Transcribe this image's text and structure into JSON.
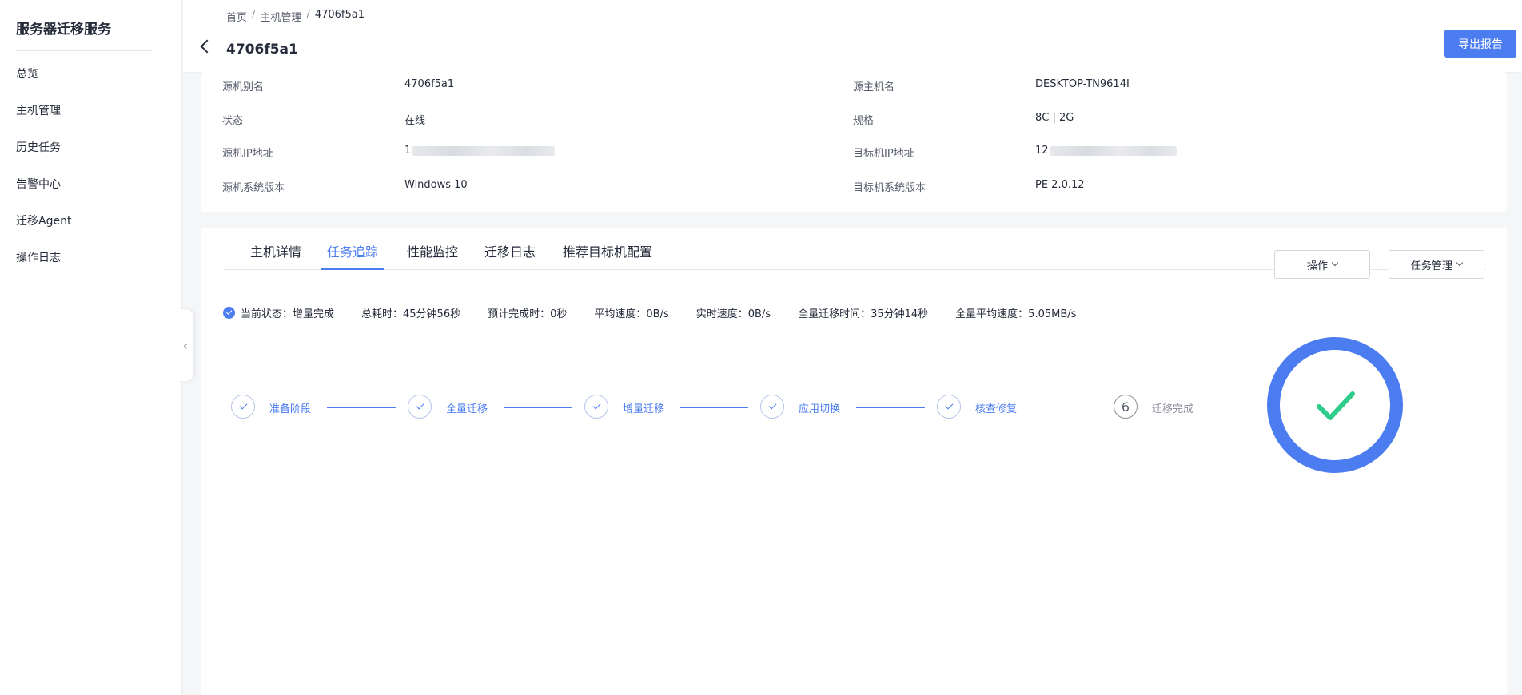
{
  "sidebar": {
    "title": "服务器迁移服务",
    "items": [
      {
        "label": "总览"
      },
      {
        "label": "主机管理"
      },
      {
        "label": "历史任务"
      },
      {
        "label": "告警中心"
      },
      {
        "label": "迁移Agent"
      },
      {
        "label": "操作日志"
      }
    ]
  },
  "header": {
    "breadcrumb": [
      "首页",
      "主机管理",
      "4706f5a1"
    ],
    "breadcrumb_sep": "/",
    "title": "4706f5a1",
    "export_label": "导出报告"
  },
  "info": {
    "source_alias_label": "源机别名",
    "source_alias": "4706f5a1",
    "source_host_label": "源主机名",
    "source_host": "DESKTOP-TN9614I",
    "status_label": "状态",
    "status": "在线",
    "spec_label": "规格",
    "spec": "8C | 2G",
    "source_ip_label": "源机IP地址",
    "source_ip_prefix": "1",
    "target_ip_label": "目标机IP地址",
    "target_ip_prefix": "12",
    "source_os_label": "源机系统版本",
    "source_os": "Windows 10",
    "target_os_label": "目标机系统版本",
    "target_os": "PE 2.0.12"
  },
  "tabs": [
    {
      "label": "主机详情"
    },
    {
      "label": "任务追踪"
    },
    {
      "label": "性能监控"
    },
    {
      "label": "迁移日志"
    },
    {
      "label": "推荐目标机配置"
    }
  ],
  "actions": {
    "operate": "操作",
    "task_manage": "任务管理"
  },
  "status_bar": {
    "current_state": "当前状态：增量完成",
    "total_time": "总耗时：45分钟56秒",
    "eta": "预计完成时：0秒",
    "avg_speed": "平均速度：0B/s",
    "realtime_speed": "实时速度：0B/s",
    "full_time": "全量迁移时间：35分钟14秒",
    "full_avg_speed": "全量平均速度：5.05MB/s"
  },
  "steps": [
    {
      "label": "准备阶段",
      "state": "done"
    },
    {
      "label": "全量迁移",
      "state": "done"
    },
    {
      "label": "增量迁移",
      "state": "done"
    },
    {
      "label": "应用切换",
      "state": "done"
    },
    {
      "label": "核查修复",
      "state": "done"
    },
    {
      "label": "迁移完成",
      "number": "6",
      "state": "pending"
    }
  ],
  "colors": {
    "primary": "#4b7cf0",
    "success": "#2ecc8a"
  }
}
